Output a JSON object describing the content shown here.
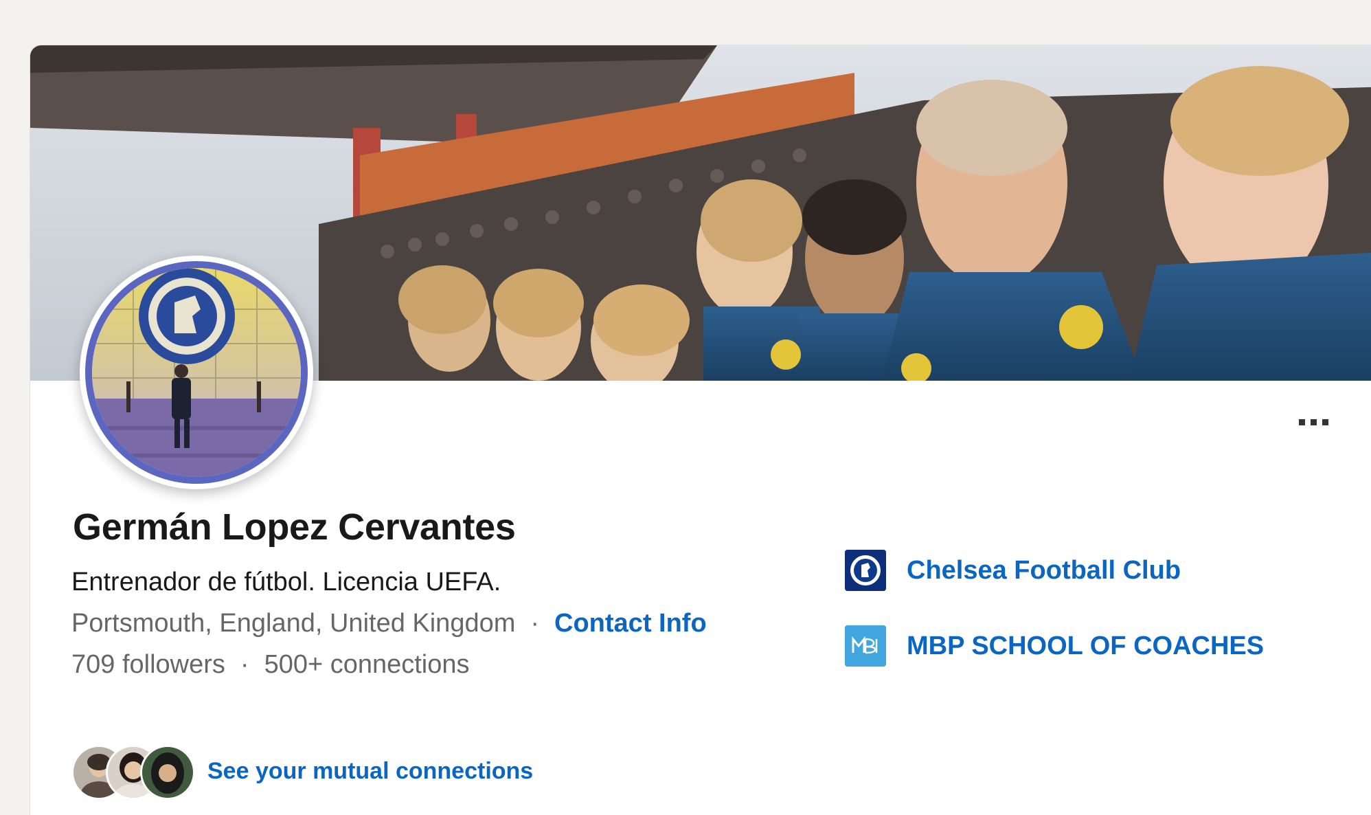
{
  "profile": {
    "name": "Germán Lopez Cervantes",
    "headline": "Entrenador de fútbol. Licencia UEFA.",
    "location": "Portsmouth, England, United Kingdom",
    "separator": "·",
    "contact_info_label": "Contact Info",
    "followers": "709 followers",
    "connections": "500+ connections",
    "mutual_connections_label": "See your mutual connections"
  },
  "organizations": [
    {
      "name": "Chelsea Football Club",
      "icon": "chelsea-crest-icon",
      "color": "#034694"
    },
    {
      "name": "MBP SCHOOL OF COACHES",
      "icon": "mbp-logo-icon",
      "color": "#3fa2e0"
    }
  ],
  "actions": {
    "more_icon": "ellipsis-icon"
  },
  "colors": {
    "link": "#0a66c2",
    "text_primary": "#191919",
    "text_secondary": "#666666",
    "avatar_ring": "#5a66c0"
  }
}
